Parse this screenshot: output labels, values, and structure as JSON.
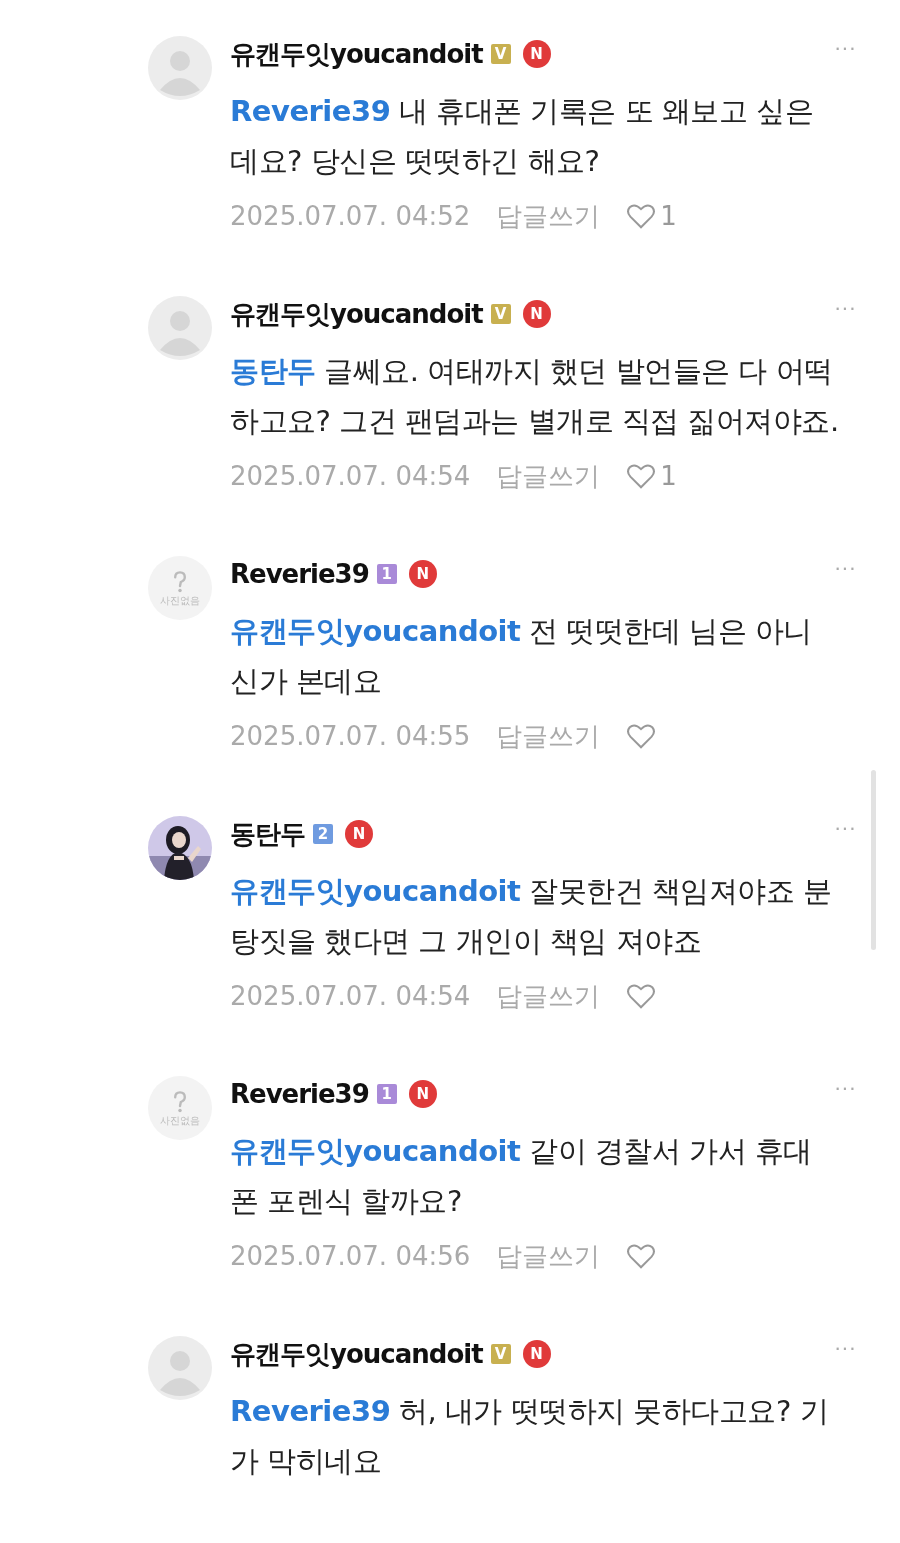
{
  "comments": [
    {
      "author": "유캔두잇youcandoit",
      "avatar": {
        "kind": "default"
      },
      "badge": {
        "text": "V",
        "color": "#c8b050"
      },
      "new_mark": "N",
      "mention": "Reverie39",
      "text": "내 휴대폰 기록은 또 왜보고 싶은데요? 당신은 떳떳하긴 해요?",
      "time": "2025.07.07. 04:52",
      "reply_label": "답글쓰기",
      "likes": "1",
      "more": "···"
    },
    {
      "author": "유캔두잇youcandoit",
      "avatar": {
        "kind": "default"
      },
      "badge": {
        "text": "V",
        "color": "#c8b050"
      },
      "new_mark": "N",
      "mention": "동탄두",
      "text": "글쎄요. 여태까지 했던 발언들은 다 어떡하고요? 그건 팬덤과는 별개로 직접 짊어져야죠.",
      "time": "2025.07.07. 04:54",
      "reply_label": "답글쓰기",
      "likes": "1",
      "more": "···"
    },
    {
      "author": "Reverie39",
      "avatar": {
        "kind": "no_photo",
        "caption": "사진없음"
      },
      "badge": {
        "text": "1",
        "color": "#a98ad8"
      },
      "new_mark": "N",
      "mention": "유캔두잇youcandoit",
      "text": "전 떳떳한데 님은 아니신가 본데요",
      "time": "2025.07.07. 04:55",
      "reply_label": "답글쓰기",
      "more": "···"
    },
    {
      "author": "동탄두",
      "badge": {
        "text": "2",
        "color": "#6f9be0"
      },
      "new_mark": "N",
      "mention": "유캔두잇youcandoit",
      "text": "잘못한건 책임져야죠 분탕짓을 했다면 그 개인이 책임 져야죠",
      "time": "2025.07.07. 04:54",
      "reply_label": "답글쓰기",
      "more": "···"
    },
    {
      "author": "Reverie39",
      "avatar": {
        "kind": "no_photo",
        "caption": "사진없음"
      },
      "badge": {
        "text": "1",
        "color": "#a98ad8"
      },
      "new_mark": "N",
      "mention": "유캔두잇youcandoit",
      "text": "같이 경찰서 가서 휴대폰 포렌식 할까요?",
      "time": "2025.07.07. 04:56",
      "reply_label": "답글쓰기",
      "more": "···"
    },
    {
      "author": "유캔두잇youcandoit",
      "avatar": {
        "kind": "default"
      },
      "badge": {
        "text": "V",
        "color": "#c8b050"
      },
      "new_mark": "N",
      "mention": "Reverie39",
      "text": "허, 내가 떳떳하지 못하다고요? 기가 막히네요",
      "more": "···"
    }
  ]
}
